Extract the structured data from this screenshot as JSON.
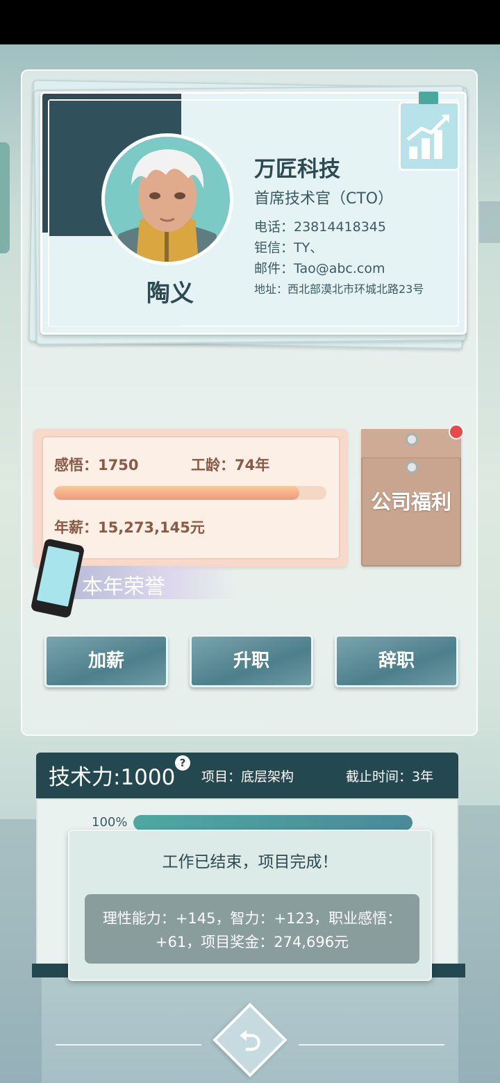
{
  "card": {
    "name": "陶义",
    "company": "万匠科技",
    "position": "首席技术官（CTO）",
    "phone": "电话：23814418345",
    "chat": "钜信：TY、",
    "email": "邮件：Tao@abc.com",
    "address": "地址：西北部漠北市环城北路23号"
  },
  "stats": {
    "insight": "感悟：1750",
    "seniority": "工龄：74年",
    "salary": "年薪：15,273,145元",
    "progress_fraction": 0.9
  },
  "welfare": {
    "label": "公司福利",
    "has_notification": true
  },
  "honor": {
    "label": "本年荣誉"
  },
  "actions": {
    "raise": "加薪",
    "promote": "升职",
    "resign": "辞职"
  },
  "project": {
    "tech_power": "技术力:1000",
    "help_icon": "?",
    "name": "项目：底层架构",
    "deadline": "截止时间：3年",
    "progress_label": "100%",
    "progress_fraction": 1.0
  },
  "result": {
    "title": "工作已结束，项目完成！",
    "detail": "理性能力：+145，智力：+123，职业感悟：+61，项目奖金：274,696元"
  },
  "icons": {
    "chart": "growth-chart-icon",
    "phone": "phone-icon",
    "back": "back-arrow-icon"
  },
  "colors": {
    "primary_dark": "#24484f",
    "accent_teal": "#4ea8a0",
    "salary_bar": "#f0987c",
    "notification": "#e84a4a"
  }
}
